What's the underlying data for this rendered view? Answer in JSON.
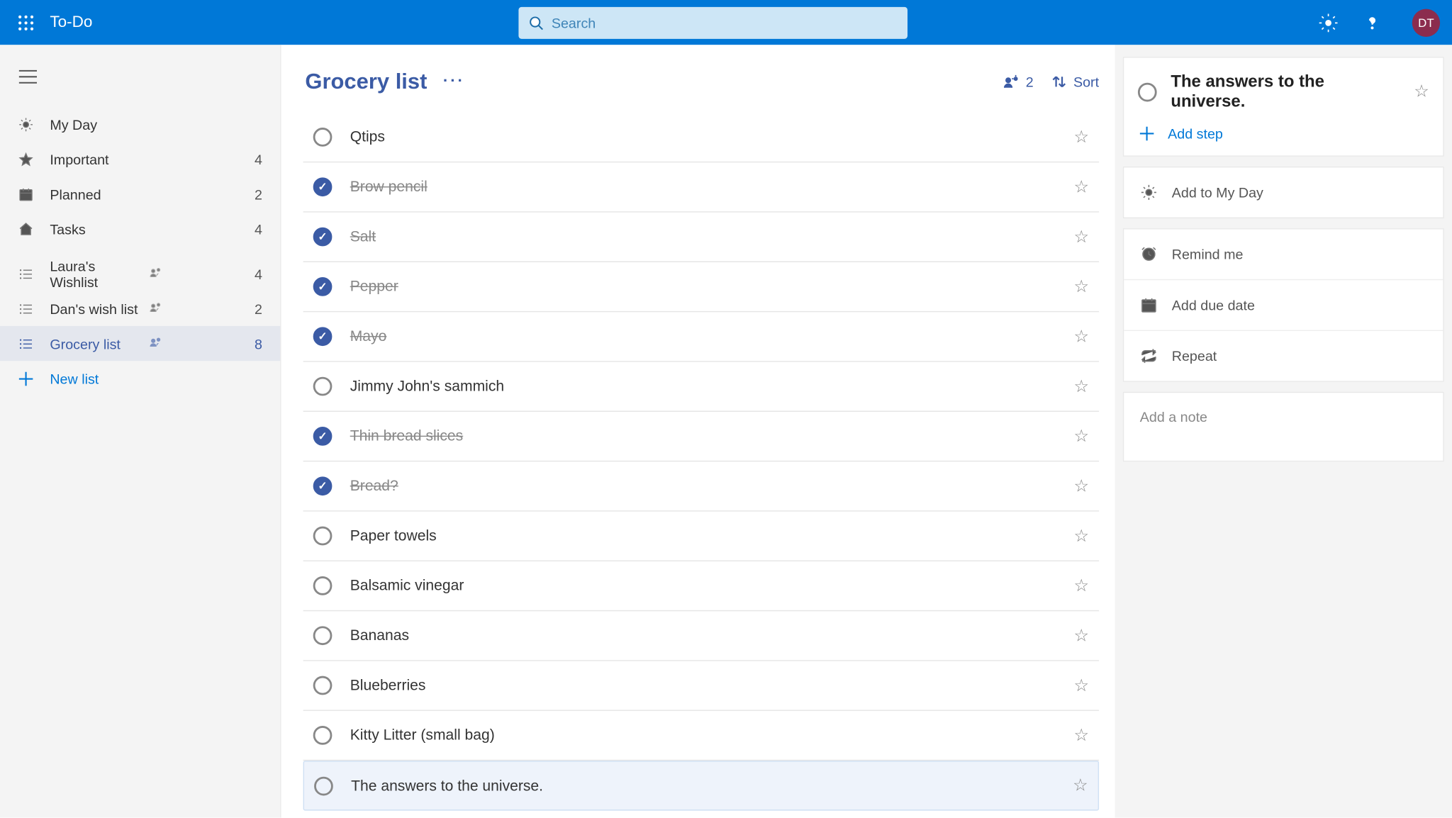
{
  "header": {
    "app_title": "To-Do",
    "search_placeholder": "Search",
    "avatar_initials": "DT"
  },
  "sidebar": {
    "smart_lists": [
      {
        "icon": "sun",
        "label": "My Day",
        "count": ""
      },
      {
        "icon": "star",
        "label": "Important",
        "count": "4"
      },
      {
        "icon": "calendar",
        "label": "Planned",
        "count": "2"
      },
      {
        "icon": "home",
        "label": "Tasks",
        "count": "4"
      }
    ],
    "user_lists": [
      {
        "label": "Laura's Wishlist",
        "count": "4",
        "shared": true,
        "active": false
      },
      {
        "label": "Dan's wish list",
        "count": "2",
        "shared": true,
        "active": false
      },
      {
        "label": "Grocery list",
        "count": "8",
        "shared": true,
        "active": true
      }
    ],
    "new_list_label": "New list"
  },
  "list": {
    "title": "Grocery list",
    "share_count": "2",
    "sort_label": "Sort",
    "tasks": [
      {
        "title": "Qtips",
        "done": false,
        "selected": false
      },
      {
        "title": "Brow pencil",
        "done": true,
        "selected": false
      },
      {
        "title": "Salt",
        "done": true,
        "selected": false
      },
      {
        "title": "Pepper",
        "done": true,
        "selected": false
      },
      {
        "title": "Mayo",
        "done": true,
        "selected": false
      },
      {
        "title": "Jimmy John's sammich",
        "done": false,
        "selected": false
      },
      {
        "title": "Thin bread slices",
        "done": true,
        "selected": false
      },
      {
        "title": "Bread?",
        "done": true,
        "selected": false
      },
      {
        "title": "Paper towels",
        "done": false,
        "selected": false
      },
      {
        "title": "Balsamic vinegar",
        "done": false,
        "selected": false
      },
      {
        "title": "Bananas",
        "done": false,
        "selected": false
      },
      {
        "title": "Blueberries",
        "done": false,
        "selected": false
      },
      {
        "title": "Kitty Litter (small bag)",
        "done": false,
        "selected": false
      },
      {
        "title": "The answers to the universe.",
        "done": false,
        "selected": true
      }
    ]
  },
  "details": {
    "title": "The answers to the universe.",
    "add_step_label": "Add step",
    "add_myday_label": "Add to My Day",
    "remind_label": "Remind me",
    "due_label": "Add due date",
    "repeat_label": "Repeat",
    "note_placeholder": "Add a note"
  }
}
